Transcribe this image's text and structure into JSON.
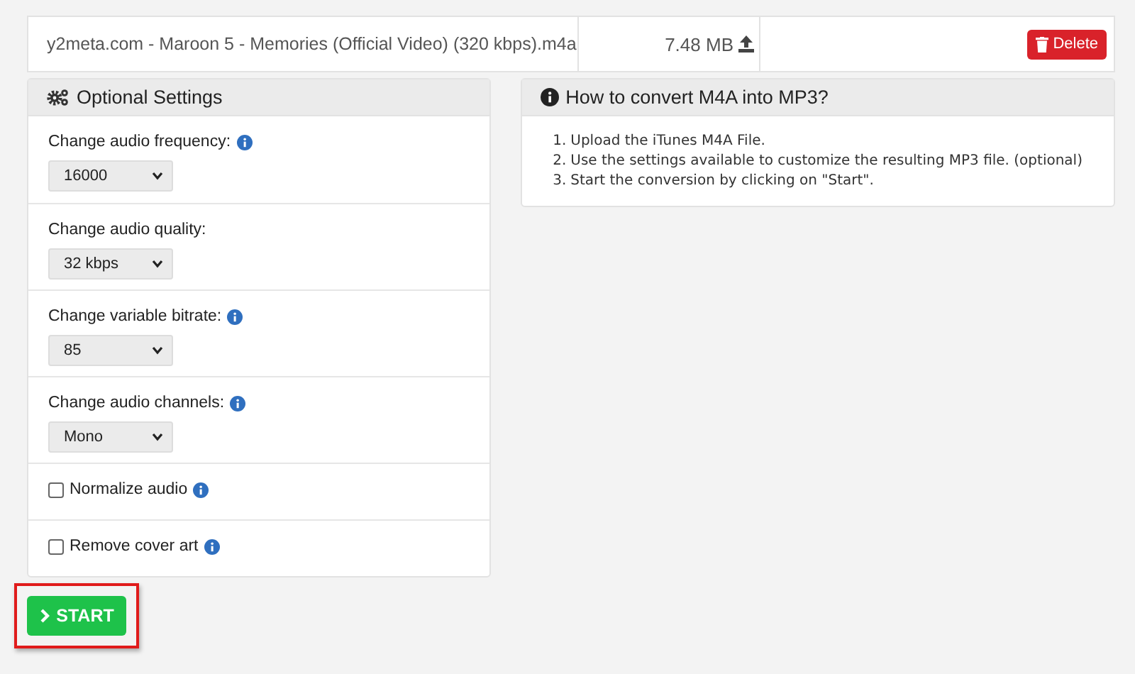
{
  "file": {
    "name": "y2meta.com - Maroon 5 - Memories (Official Video) (320 kbps).m4a",
    "size": "7.48 MB",
    "delete_label": "Delete"
  },
  "settings": {
    "title": "Optional Settings",
    "items": [
      {
        "kind": "select",
        "label": "Change audio frequency:",
        "info": true,
        "value": "16000"
      },
      {
        "kind": "select",
        "label": "Change audio quality:",
        "info": false,
        "value": "32 kbps"
      },
      {
        "kind": "select",
        "label": "Change variable bitrate:",
        "info": true,
        "value": "85"
      },
      {
        "kind": "select",
        "label": "Change audio channels:",
        "info": true,
        "value": "Mono"
      },
      {
        "kind": "checkbox",
        "label": "Normalize audio",
        "info": true,
        "checked": false
      },
      {
        "kind": "checkbox",
        "label": "Remove cover art",
        "info": true,
        "checked": false
      }
    ]
  },
  "howto": {
    "title": "How to convert M4A into MP3?",
    "steps": [
      {
        "number": "1.",
        "text": "Upload the iTunes M4A File."
      },
      {
        "number": "2.",
        "text": "Use the settings available to customize the resulting MP3 file. (optional)"
      },
      {
        "number": "3.",
        "text": "Start the conversion by clicking on \"Start\"."
      }
    ]
  },
  "start": {
    "label": "START",
    "highlighted": true
  }
}
